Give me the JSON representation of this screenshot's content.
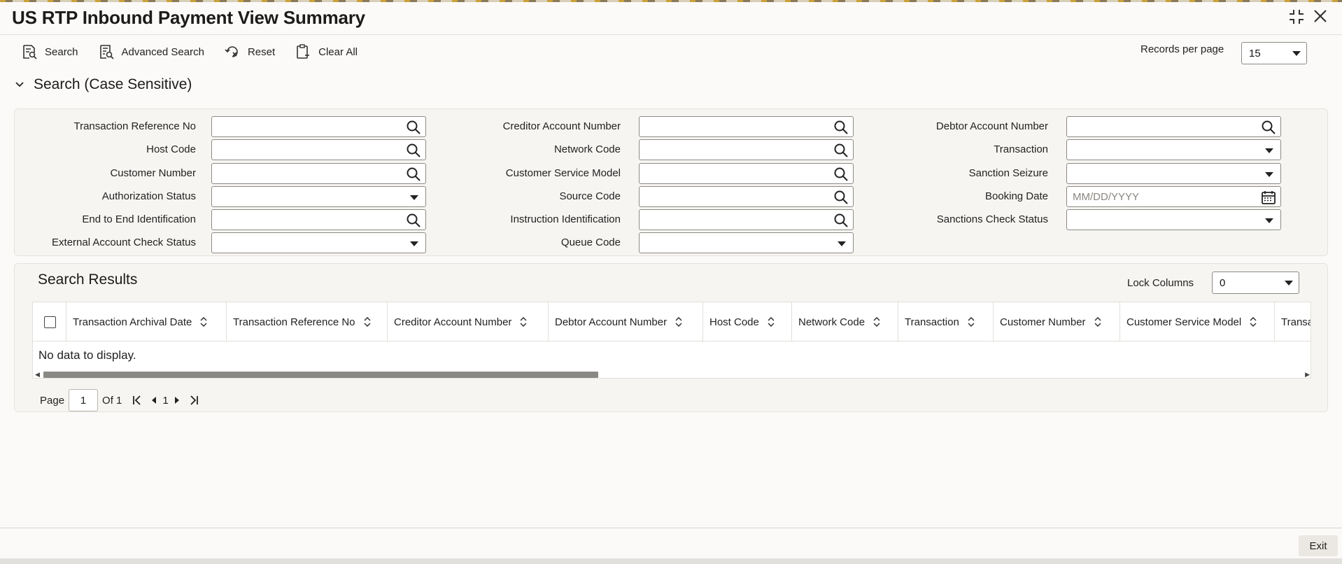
{
  "window": {
    "title": "US RTP Inbound Payment View Summary"
  },
  "toolbar": {
    "search": "Search",
    "advanced_search": "Advanced Search",
    "reset": "Reset",
    "clear_all": "Clear All"
  },
  "records_per_page": {
    "label": "Records per page",
    "value": "15"
  },
  "search_section": {
    "title": "Search (Case Sensitive)",
    "fields": {
      "transaction_reference_no": "Transaction Reference No",
      "creditor_account_number": "Creditor Account Number",
      "debtor_account_number": "Debtor Account Number",
      "host_code": "Host Code",
      "network_code": "Network Code",
      "transaction": "Transaction",
      "customer_number": "Customer Number",
      "customer_service_model": "Customer Service Model",
      "sanction_seizure": "Sanction Seizure",
      "authorization_status": "Authorization Status",
      "source_code": "Source Code",
      "booking_date": "Booking Date",
      "booking_date_placeholder": "MM/DD/YYYY",
      "end_to_end_identification": "End to End Identification",
      "instruction_identification": "Instruction Identification",
      "sanctions_check_status": "Sanctions Check Status",
      "external_account_check_status": "External Account Check Status",
      "queue_code": "Queue Code"
    }
  },
  "results": {
    "title": "Search Results",
    "lock_columns_label": "Lock Columns",
    "lock_columns_value": "0",
    "columns": [
      "Transaction Archival Date",
      "Transaction Reference No",
      "Creditor Account Number",
      "Debtor Account Number",
      "Host Code",
      "Network Code",
      "Transaction",
      "Customer Number",
      "Customer Service Model",
      "Transa"
    ],
    "empty_text": "No data to display."
  },
  "pager": {
    "page_label": "Page",
    "page_value": "1",
    "of_label": "Of 1",
    "current": "1"
  },
  "footer": {
    "exit": "Exit"
  }
}
